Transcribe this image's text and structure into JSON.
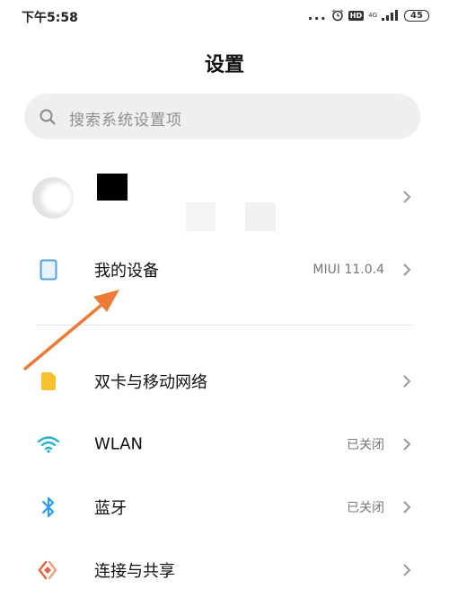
{
  "status_bar": {
    "time": "下午5:58",
    "dots": "...",
    "hd": "HD",
    "network": "4G",
    "battery": "45"
  },
  "header": {
    "title": "设置"
  },
  "search": {
    "placeholder": "搜索系统设置项"
  },
  "rows": {
    "my_device": {
      "label": "我的设备",
      "value": "MIUI 11.0.4"
    },
    "dual_sim": {
      "label": "双卡与移动网络"
    },
    "wlan": {
      "label": "WLAN",
      "value": "已关闭"
    },
    "bluetooth": {
      "label": "蓝牙",
      "value": "已关闭"
    },
    "connection_sharing": {
      "label": "连接与共享"
    }
  },
  "colors": {
    "accent_arrow": "#ee7b35",
    "device_icon": "#4da3e8",
    "sim_icon": "#f6c02e",
    "wlan_icon": "#26b3c8",
    "bluetooth_icon": "#2a9df4",
    "sharing_icon": "#e8603c"
  }
}
